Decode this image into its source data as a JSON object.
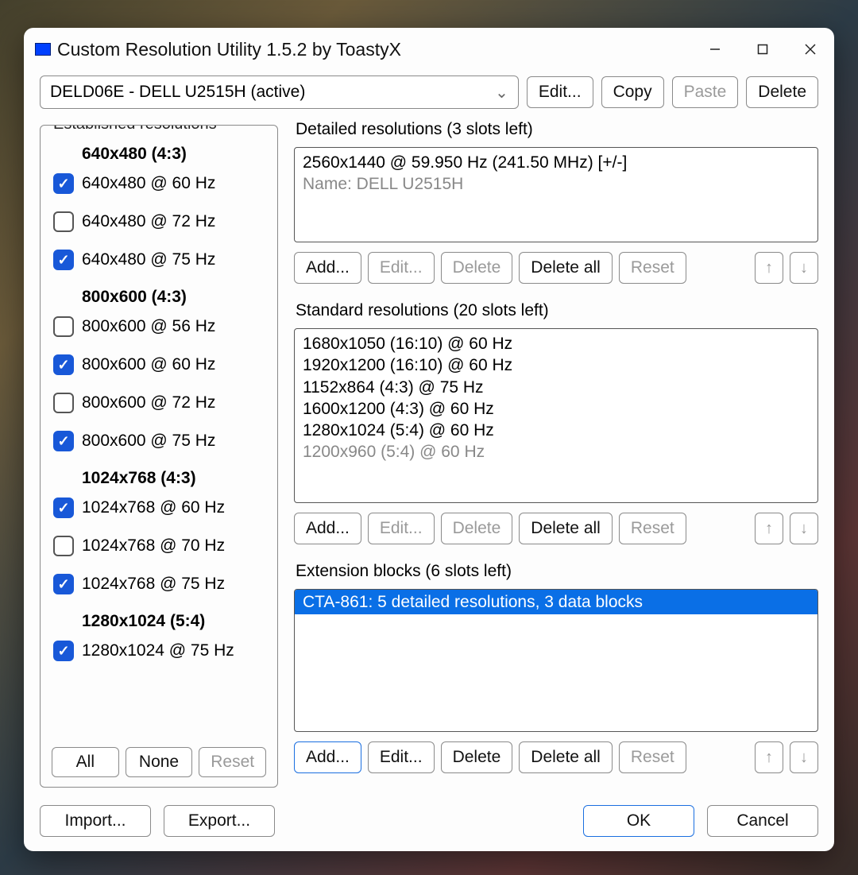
{
  "window_title": "Custom Resolution Utility 1.5.2 by ToastyX",
  "monitor_combo": "DELD06E - DELL U2515H (active)",
  "toolbar": {
    "edit": "Edit...",
    "copy": "Copy",
    "paste": "Paste",
    "delete": "Delete"
  },
  "established": {
    "title": "Established resolutions",
    "groups": [
      {
        "header": "640x480 (4:3)",
        "items": [
          {
            "label": "640x480 @ 60 Hz",
            "checked": true
          },
          {
            "label": "640x480 @ 72 Hz",
            "checked": false
          },
          {
            "label": "640x480 @ 75 Hz",
            "checked": true
          }
        ]
      },
      {
        "header": "800x600 (4:3)",
        "items": [
          {
            "label": "800x600 @ 56 Hz",
            "checked": false
          },
          {
            "label": "800x600 @ 60 Hz",
            "checked": true
          },
          {
            "label": "800x600 @ 72 Hz",
            "checked": false
          },
          {
            "label": "800x600 @ 75 Hz",
            "checked": true
          }
        ]
      },
      {
        "header": "1024x768 (4:3)",
        "items": [
          {
            "label": "1024x768 @ 60 Hz",
            "checked": true
          },
          {
            "label": "1024x768 @ 70 Hz",
            "checked": false
          },
          {
            "label": "1024x768 @ 75 Hz",
            "checked": true
          }
        ]
      },
      {
        "header": "1280x1024 (5:4)",
        "items": [
          {
            "label": "1280x1024 @ 75 Hz",
            "checked": true
          }
        ]
      }
    ],
    "btn_all": "All",
    "btn_none": "None",
    "btn_reset": "Reset"
  },
  "detailed": {
    "title": "Detailed resolutions (3 slots left)",
    "items": [
      {
        "text": "2560x1440 @ 59.950 Hz (241.50 MHz) [+/-]",
        "muted": false
      },
      {
        "text": "Name: DELL U2515H",
        "muted": true
      }
    ],
    "btn_add": "Add...",
    "btn_edit": "Edit...",
    "btn_delete": "Delete",
    "btn_delall": "Delete all",
    "btn_reset": "Reset"
  },
  "standard": {
    "title": "Standard resolutions (20 slots left)",
    "items": [
      {
        "text": "1680x1050 (16:10) @ 60 Hz",
        "muted": false
      },
      {
        "text": "1920x1200 (16:10) @ 60 Hz",
        "muted": false
      },
      {
        "text": "1152x864 (4:3) @ 75 Hz",
        "muted": false
      },
      {
        "text": "1600x1200 (4:3) @ 60 Hz",
        "muted": false
      },
      {
        "text": "1280x1024 (5:4) @ 60 Hz",
        "muted": false
      },
      {
        "text": "1200x960 (5:4) @ 60 Hz",
        "muted": true
      }
    ],
    "btn_add": "Add...",
    "btn_edit": "Edit...",
    "btn_delete": "Delete",
    "btn_delall": "Delete all",
    "btn_reset": "Reset"
  },
  "ext": {
    "title": "Extension blocks (6 slots left)",
    "items": [
      {
        "text": "CTA-861: 5 detailed resolutions, 3 data blocks",
        "selected": true
      }
    ],
    "btn_add": "Add...",
    "btn_edit": "Edit...",
    "btn_delete": "Delete",
    "btn_delall": "Delete all",
    "btn_reset": "Reset"
  },
  "footer": {
    "import": "Import...",
    "export": "Export...",
    "ok": "OK",
    "cancel": "Cancel"
  }
}
